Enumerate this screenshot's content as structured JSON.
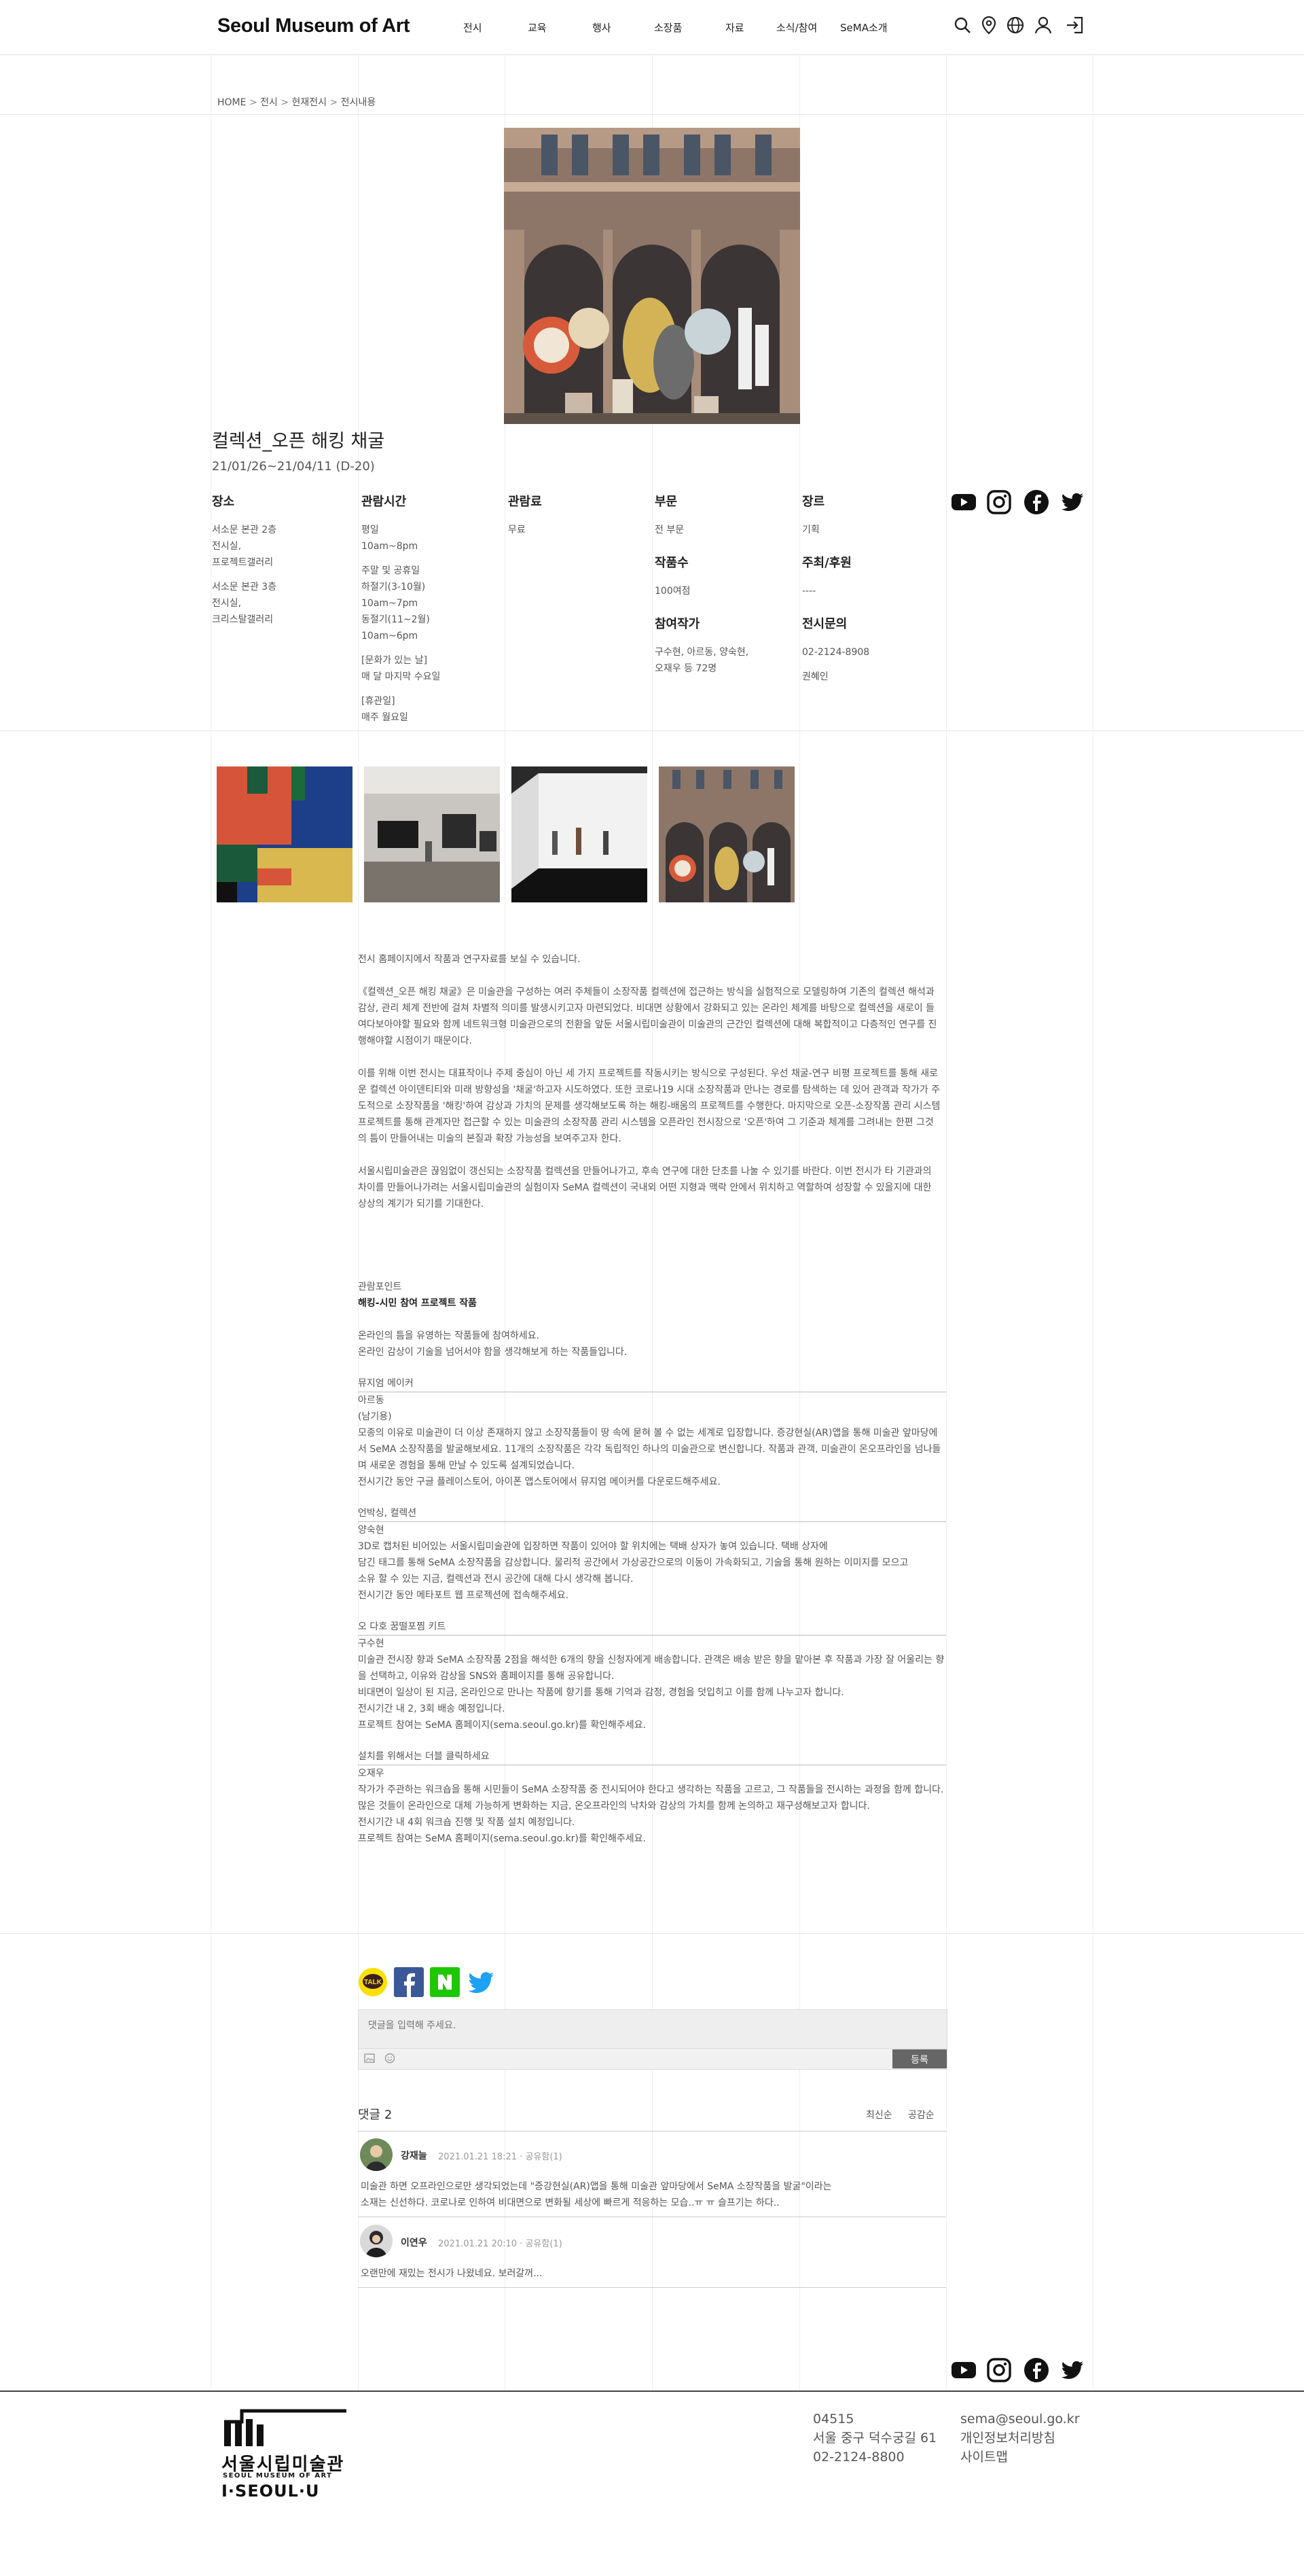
{
  "header": {
    "logo": "Seoul Museum of Art",
    "nav": [
      "전시",
      "교육",
      "행사",
      "소장품",
      "자료",
      "소식/참여",
      "SeMA소개"
    ]
  },
  "breadcrumb": {
    "home": "HOME",
    "sep": ">",
    "items": [
      "전시",
      "현재전시",
      "전시내용"
    ]
  },
  "exhibition": {
    "title": "컬렉션_오픈 해킹 채굴",
    "dates": "21/01/26~21/04/11 (D-20)"
  },
  "info": {
    "venue": {
      "heading": "장소",
      "lines1": [
        "서소문 본관 2층",
        "전시실,",
        "프로젝트갤러리"
      ],
      "lines2": [
        "서소문 본관 3층",
        "전시실,",
        "크리스탈갤러리"
      ]
    },
    "hours": {
      "heading": "관람시간",
      "weekday": [
        "평일",
        "10am~8pm"
      ],
      "weekend": [
        "주말 및 공휴일",
        "하절기(3-10월)",
        "10am~7pm",
        "동절기(11~2월)",
        "10am~6pm"
      ],
      "culture": [
        "[문화가 있는 날]",
        "매 달 마지막 수요일"
      ],
      "closed": [
        "[휴관일]",
        "매주 월요일"
      ]
    },
    "fee": {
      "heading": "관람료",
      "value": "무료"
    },
    "section": {
      "heading": "부문",
      "value": "전 부문"
    },
    "works": {
      "heading": "작품수",
      "value": "100여점"
    },
    "artists": {
      "heading": "참여작가",
      "lines": [
        "구수현, 아르동, 양숙현,",
        "오재우 등 72명"
      ]
    },
    "genre": {
      "heading": "장르",
      "value": "기획"
    },
    "host": {
      "heading": "주최/후원",
      "value": "----"
    },
    "contact": {
      "heading": "전시문의",
      "phone": "02-2124-8908",
      "person": "권혜인"
    }
  },
  "icons": {
    "social": [
      "youtube-icon",
      "instagram-icon",
      "facebook-icon",
      "twitter-icon"
    ],
    "share": [
      "kakaotalk-icon",
      "facebook-icon",
      "naver-icon",
      "twitter-icon"
    ]
  },
  "description": {
    "paragraphs": [
      "전시 홈페이지에서 작품과 연구자료를 보실 수 있습니다.",
      "《컬렉션_오픈 해킹 채굴》은 미술관을 구성하는 여러 주체들이 소장작품 컬렉션에 접근하는 방식을 실험적으로 모델링하여 기존의 컬렉션 해석과 감상, 관리 체계 전반에 걸쳐 차별적 의미를 발생시키고자 마련되었다. 비대면 상황에서 강화되고 있는 온라인 체계를 바탕으로 컬렉션을 새로이 들여다보아야할 필요와 함께 네트워크형 미술관으로의 전환을 앞둔 서울시립미술관이 미술관의 근간인 컬렉션에 대해 복합적이고 다층적인 연구를 진행해야할 시점이기 때문이다.",
      "이를 위해 이번 전시는 대표작이나 주제 중심이 아닌 세 가지 프로젝트를 작동시키는 방식으로 구성된다. 우선 채굴-연구 비평 프로젝트를 통해 새로운 컬렉션 아이덴티티와 미래 방향성을 '채굴'하고자 시도하였다. 또한 코로나19 시대 소장작품과 만나는 경로를 탐색하는 데 있어 관객과 작가가 주도적으로 소장작품을 '해킹'하여 감상과 가치의 문제를 생각해보도록 하는 해킹-배움의 프로젝트를 수행한다. 마지막으로 오픈-소장작품 관리 시스템 프로젝트를 통해 관계자만 접근할 수 있는 미술관의 소장작품 관리 시스템을 오픈라인 전시장으로 '오픈'하여 그 기준과 체계를 그려내는 한편 그것의 틈이 만들어내는 미술의 본질과 확장 가능성을 보여주고자 한다.",
      "서울시립미술관은 끊임없이 갱신되는 소장작품 컬렉션을 만들어나가고, 후속 연구에 대한 단초를 나눌 수 있기를 바란다. 이번 전시가 타 기관과의 차이를 만들어나가려는 서울시립미술관의 실험이자 SeMA 컬렉션이 국내외 어떤 지형과 맥락 안에서 위치하고 역할하여 성장할 수 있을지에 대한 상상의 계기가 되기를 기대한다."
    ]
  },
  "points": {
    "label": "관람포인트",
    "title": "해킹-시민 참여 프로젝트 작품",
    "intro": [
      "온라인의 틈을 유영하는 작품들에 참여하세요.",
      "온라인 감상이 기술을 넘어서야 함을 생각해보게 하는 작품들입니다."
    ],
    "sections": [
      {
        "heading": "뮤지엄 메이커",
        "lines": [
          "아르동",
          "(남기용)",
          "모종의 이유로 미술관이 더 이상 존재하지 않고 소장작품들이 땅 속에 묻혀 볼 수 없는 세계로 입장합니다. 증강현실(AR)앱을 통해 미술관 앞마당에서 SeMA 소장작품을 발굴해보세요. 11개의 소장작품은 각각 독립적인 하나의 미술관으로 변신합니다. 작품과 관객, 미술관이 온오프라인을 넘나들며 새로운 경험을 통해 만날 수 있도록 설계되었습니다.",
          "전시기간 동안 구글 플레이스토어, 아이폰 앱스토어에서 뮤지엄 메이커를 다운로드해주세요."
        ]
      },
      {
        "heading": "언박싱, 컬렉션",
        "lines": [
          "양숙현",
          "3D로 캡처된 비어있는 서울시립미술관에 입장하면 작품이 있어야 할 위치에는 택배 상자가 놓여 있습니다. 택배 상자에",
          "담긴 태그를 통해 SeMA 소장작품을 감상합니다. 물리적 공간에서 가상공간으로의 이동이 가속화되고, 기술을 통해 원하는 이미지를 모으고",
          "소유 할 수 있는 지금, 컬렉션과 전시 공간에 대해 다시 생각해 봅니다.",
          "전시기간 동안 메타포트 웹 프로젝션에 접속해주세요."
        ]
      },
      {
        "heading": "오 다호 꿈떨포찜 키트",
        "lines": [
          "구수현",
          "미술관 전시장 향과 SeMA 소장작품 2점을 해석한 6개의 향을 신청자에게 배송합니다. 관객은 배송 받은 향을 맡아본 후 작품과 가장 잘 어울리는 향을 선택하고, 이유와 감상을 SNS와 홈페이지를 통해 공유합니다.",
          "비대면이 일상이 된 지금, 온라인으로 만나는 작품에 향기를 통해 기억과 감정, 경험을 덧입히고 이를 함께 나누고자 합니다.",
          "전시기간 내 2, 3회 배송 예정입니다.",
          "프로젝트 참여는 SeMA 홈페이지(sema.seoul.go.kr)를 확인해주세요."
        ]
      },
      {
        "heading": "설치를 위해서는 더블 클릭하세요",
        "lines": [
          "오재우",
          "작가가 주관하는 워크숍을 통해 시민들이 SeMA 소장작품 중 전시되어야 한다고 생각하는 작품을 고르고, 그 작품들을 전시하는 과정을 함께 합니다.",
          "많은 것들이 온라인으로 대체 가능하게 변화하는 지금, 온오프라인의 낙차와 감상의 가치를 함께 논의하고 재구성해보고자 합니다.",
          "전시기간 내 4회 워크숍 진행 및 작품 설치 예정입니다.",
          "프로젝트 참여는 SeMA 홈페이지(sema.seoul.go.kr)를 확인해주세요."
        ]
      }
    ]
  },
  "comments": {
    "placeholder": "댓글을 입력해 주세요.",
    "submit": "등록",
    "count_label": "댓글 2",
    "sort": [
      "최신순",
      "공감순"
    ],
    "items": [
      {
        "name": "강재늘",
        "date": "2021.01.21 18:21",
        "likes": "공유함(1)",
        "text": [
          "미술관 하면 오프라인으로만 생각되었는데 \"증강현실(AR)앱을 통해 미술관 앞마당에서 SeMA 소장작품을 발굴\"이라는",
          "소재는 신선하다. 코로나로 인하여 비대면으로 변화될 세상에 빠르게 적응하는 모습..ㅠ ㅠ 슬프기는 하다.."
        ]
      },
      {
        "name": "이연우",
        "date": "2021.01.21 20:10",
        "likes": "공유함(1)",
        "text": [
          "오랜만에 재밌는 전시가 나왔네요. 보러갈꺼..."
        ]
      }
    ]
  },
  "footer": {
    "logo_kr": "서울시립미술관",
    "logo_en": "SEOUL MUSEUM OF ART",
    "slogan": "I·SEOUL·U",
    "postcode": "04515",
    "address": "서울 중구 덕수궁길 61",
    "phone": "02-2124-8800",
    "email": "sema@seoul.go.kr",
    "privacy": "개인정보처리방침",
    "sitemap": "사이트맵"
  },
  "colors": {
    "accent": "#222222",
    "youtube": "#111111",
    "kakao": "#f9e000",
    "facebook": "#3b5998",
    "naver": "#1ec800",
    "twitter": "#1da1f2"
  }
}
